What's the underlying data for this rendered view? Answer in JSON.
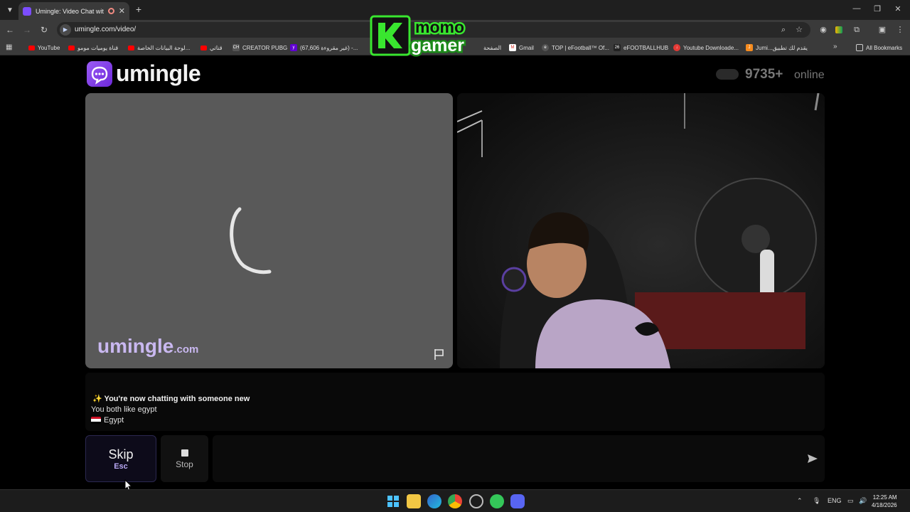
{
  "browser": {
    "tab_title": "Umingle: Video Chat with S",
    "url": "umingle.com/video/",
    "all_bookmarks_label": "All Bookmarks",
    "bookmarks": [
      {
        "label": "YouTube",
        "icon": "youtube-icon"
      },
      {
        "label": "قناة يوميات مومو",
        "icon": "youtube-icon"
      },
      {
        "label": "لوحة البيانات الخاصة...",
        "icon": "youtube-icon"
      },
      {
        "label": "قناتي",
        "icon": "youtube-icon"
      },
      {
        "label": "CREATOR PUBG",
        "icon": "ch-icon"
      },
      {
        "label": "(67,606 غير مقروءة) -...",
        "icon": "yahoo-icon"
      },
      {
        "label": "الصفحة",
        "icon": "page-icon"
      },
      {
        "label": "Gmail",
        "icon": "gmail-icon"
      },
      {
        "label": "TOP | eFootball™ Of...",
        "icon": "efootball-icon"
      },
      {
        "label": "eFOOTBALLHUB",
        "icon": "26-icon"
      },
      {
        "label": "Youtube Downloade...",
        "icon": "downloader-icon"
      },
      {
        "label": "Jumi...يقدم لك تطبيق",
        "icon": "jumia-icon"
      }
    ]
  },
  "overlay_logo": {
    "line1": "momo",
    "line2": "gamer"
  },
  "site": {
    "brand": "umingle",
    "online_count": "9735+",
    "online_label": "online",
    "watermark_main": "umingle",
    "watermark_suffix": ".com"
  },
  "chat": {
    "line1": "✨ You're now chatting with someone new",
    "line2": "You both like egypt",
    "country": "Egypt"
  },
  "controls": {
    "skip_label": "Skip",
    "skip_key": "Esc",
    "stop_label": "Stop",
    "message_placeholder": ""
  },
  "taskbar": {
    "language": "ENG",
    "time": "12:25 AM",
    "date": "4/18/2026"
  },
  "colors": {
    "brand_purple": "#7c3aed",
    "page_bg": "#000000",
    "video_placeholder": "#595959"
  }
}
